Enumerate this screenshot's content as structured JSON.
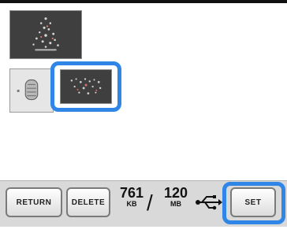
{
  "colors": {
    "selection_accent": "#2f86e6",
    "thumbnail_bg": "#3f3f3f",
    "toolbar_bg": "#d9d9d9"
  },
  "thumbnails": [
    {
      "icon": "embroidery-pattern-icon",
      "selected": false
    },
    {
      "icon": "embroidery-pattern-icon",
      "selected": false
    },
    {
      "icon": "embroidery-pattern-icon",
      "selected": true
    }
  ],
  "toolbar": {
    "return_label": "RETURN",
    "delete_label": "DELETE",
    "set_label": "SET",
    "memory_used": "761",
    "memory_used_unit": "KB",
    "memory_total": "120",
    "memory_total_unit": "MB",
    "slash": "/",
    "usb_icon": "usb-icon"
  }
}
